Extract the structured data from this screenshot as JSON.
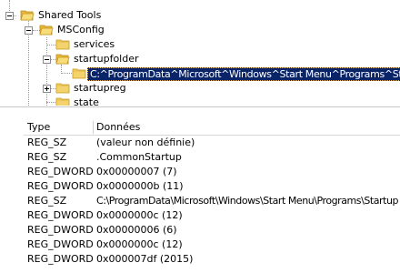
{
  "tree": {
    "nodes": [
      {
        "label": "Shared Tools",
        "expander": "minus"
      },
      {
        "label": "MSConfig",
        "expander": "minus"
      },
      {
        "label": "services",
        "expander": "none"
      },
      {
        "label": "startupfolder",
        "expander": "minus"
      },
      {
        "label": "C:^ProgramData^Microsoft^Windows^Start Menu^Programs^Startup",
        "expander": "none",
        "selected": true
      },
      {
        "label": "startupreg",
        "expander": "plus"
      },
      {
        "label": "state",
        "expander": "none"
      }
    ]
  },
  "list": {
    "columns": {
      "type": "Type",
      "data": "Données"
    },
    "rows": [
      {
        "type": "REG_SZ",
        "data": "(valeur non définie)"
      },
      {
        "type": "REG_SZ",
        "data": ".CommonStartup"
      },
      {
        "type": "REG_DWORD",
        "data": "0x00000007 (7)"
      },
      {
        "type": "REG_DWORD",
        "data": "0x0000000b (11)"
      },
      {
        "type": "REG_SZ",
        "data": "C:\\ProgramData\\Microsoft\\Windows\\Start Menu\\Programs\\Startup"
      },
      {
        "type": "REG_DWORD",
        "data": "0x0000000c (12)"
      },
      {
        "type": "REG_DWORD",
        "data": "0x00000006 (6)"
      },
      {
        "type": "REG_DWORD",
        "data": "0x0000000c (12)"
      },
      {
        "type": "REG_DWORD",
        "data": "0x000007df (2015)"
      }
    ]
  },
  "colors": {
    "selection_bg": "#0a246a",
    "selection_text": "#ffffff",
    "folder_yellow": "#f5d36c"
  },
  "icons": {
    "folder": "folder-icon",
    "folder_open": "folder-open-icon",
    "expand": "plus-expander-icon",
    "collapse": "minus-expander-icon"
  }
}
